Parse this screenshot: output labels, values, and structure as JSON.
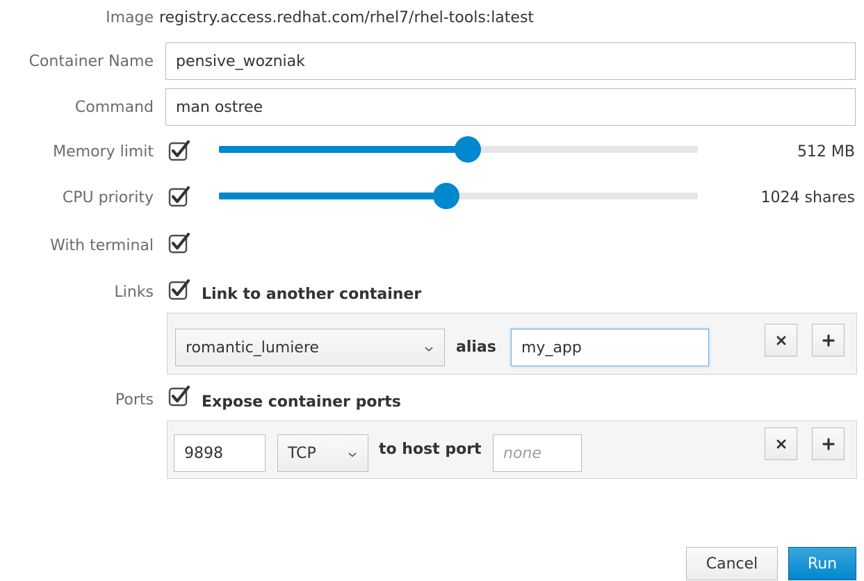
{
  "form": {
    "image": {
      "label": "Image",
      "value": "registry.access.redhat.com/rhel7/rhel-tools:latest"
    },
    "container_name": {
      "label": "Container Name",
      "value": "pensive_wozniak"
    },
    "command": {
      "label": "Command",
      "value": "man ostree"
    },
    "memory_limit": {
      "label": "Memory limit",
      "checked": true,
      "slider_fraction": 0.52,
      "value_text": "512 MB"
    },
    "cpu_priority": {
      "label": "CPU priority",
      "checked": true,
      "slider_fraction": 0.475,
      "value_text": "1024 shares"
    },
    "with_terminal": {
      "label": "With terminal",
      "checked": true
    },
    "links": {
      "label": "Links",
      "checked": true,
      "heading": "Link to another container",
      "container_select": "romantic_lumiere",
      "alias_label": "alias",
      "alias_value": "my_app"
    },
    "ports": {
      "label": "Ports",
      "checked": true,
      "heading": "Expose container ports",
      "container_port": "9898",
      "protocol": "TCP",
      "to_host_label": "to host port",
      "host_port_placeholder": "none"
    }
  },
  "buttons": {
    "cancel": "Cancel",
    "run": "Run"
  },
  "icons": {
    "checkbox": "check-icon",
    "select_arrow": "chevron-down-icon",
    "remove": "close-icon",
    "add": "plus-icon"
  },
  "colors": {
    "accent": "#0088ce",
    "label": "#6b6b6b",
    "track": "#e6e6e6"
  }
}
